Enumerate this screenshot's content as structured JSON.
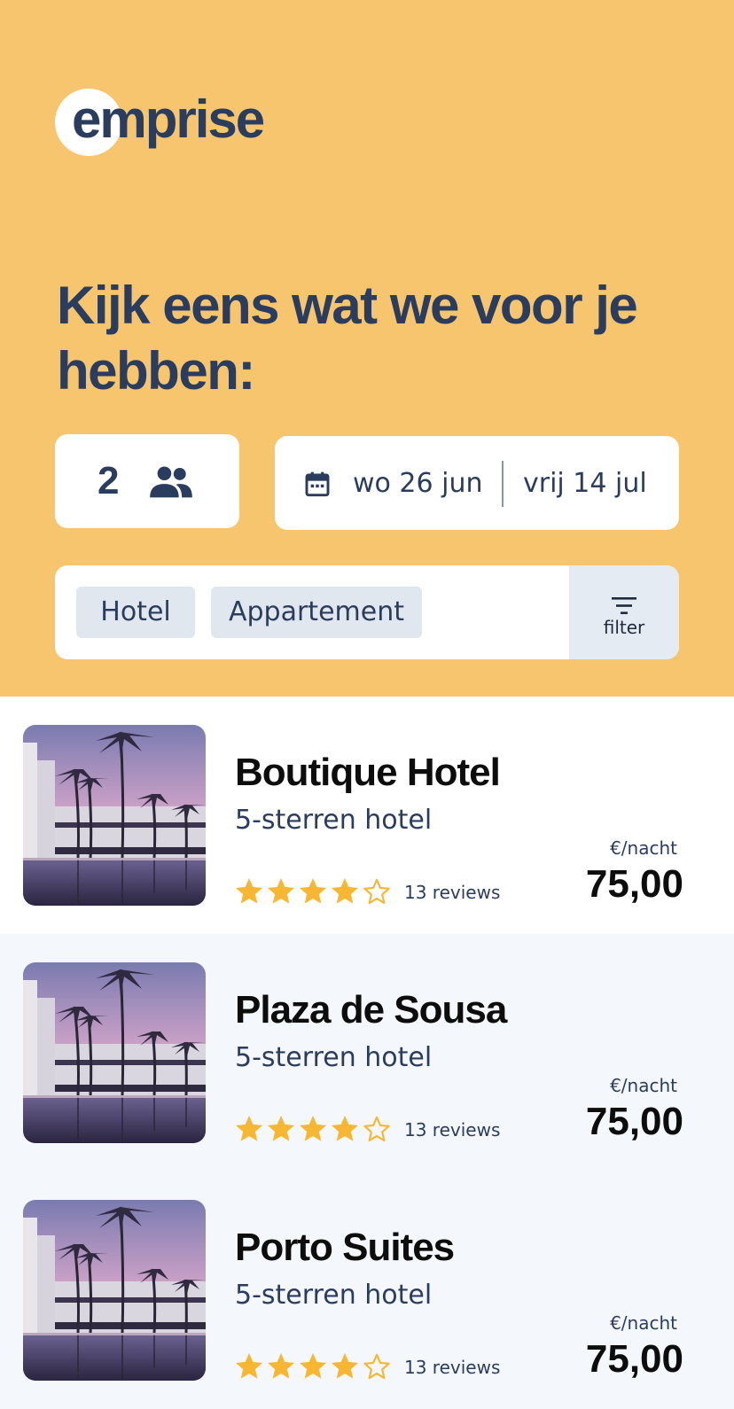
{
  "brand": {
    "name": "emprise"
  },
  "hero": {
    "headline": "Kijk eens wat we voor je hebben:",
    "background": "#f7c56e",
    "text_color": "#2b3d5e"
  },
  "search": {
    "guests": {
      "count": "2",
      "icon": "people-icon"
    },
    "dates": {
      "icon": "calendar-icon",
      "from": "wo 26 jun",
      "to": "vrij 14 jul"
    },
    "types": [
      "Hotel",
      "Appartement"
    ],
    "filter": {
      "label": "filter",
      "icon": "filter-icon"
    }
  },
  "results": [
    {
      "name": "Boutique Hotel",
      "type": "5-sterren hotel",
      "rating": 4,
      "rating_max": 5,
      "reviews": "13 reviews",
      "unit": "€/nacht",
      "price": "75,00"
    },
    {
      "name": "Plaza de Sousa",
      "type": "5-sterren hotel",
      "rating": 4,
      "rating_max": 5,
      "reviews": "13 reviews",
      "unit": "€/nacht",
      "price": "75,00"
    },
    {
      "name": "Porto Suites",
      "type": "5-sterren hotel",
      "rating": 4,
      "rating_max": 5,
      "reviews": "13 reviews",
      "unit": "€/nacht",
      "price": "75,00"
    }
  ],
  "colors": {
    "star": "#f7b733",
    "row_alt": "#f4f7fb"
  }
}
